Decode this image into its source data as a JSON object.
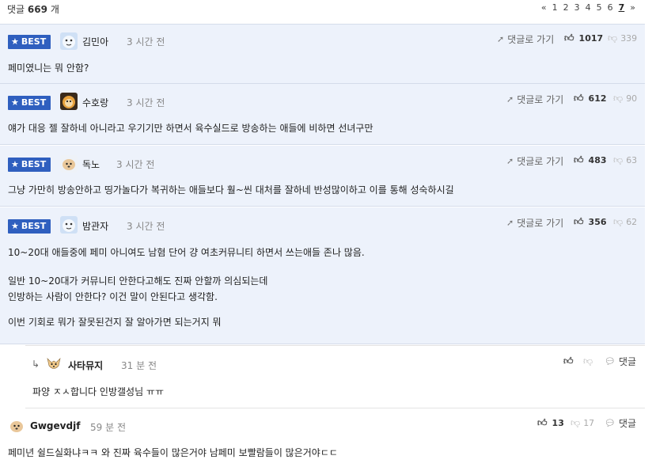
{
  "header": {
    "count_label": "댓글",
    "count_value": "669",
    "count_unit": "개",
    "pager": {
      "prev": "«",
      "pages": [
        "1",
        "2",
        "3",
        "4",
        "5",
        "6",
        "7"
      ],
      "current": "7",
      "next": "»"
    }
  },
  "labels": {
    "best": "BEST",
    "goto": "댓글로 가기",
    "reply": "댓글"
  },
  "best_comments": [
    {
      "nick": "김민아",
      "time": "3 시간 전",
      "likes": "1017",
      "dislikes": "339",
      "text": [
        "페미였니는 뭐 안함?"
      ]
    },
    {
      "nick": "수호랑",
      "time": "3 시간 전",
      "likes": "612",
      "dislikes": "90",
      "text": [
        "얘가 대응 젤 잘하네 아니라고 우기기만 하면서 육수실드로 방송하는 애들에 비하면 선녀구만"
      ]
    },
    {
      "nick": "독노",
      "time": "3 시간 전",
      "likes": "483",
      "dislikes": "63",
      "text": [
        "그냥 가만히 방송안하고 띵가놀다가 복귀하는 애들보다 훨~씬 대처를 잘하네 반성많이하고 이를 통해 성숙하시길"
      ]
    },
    {
      "nick": "밤관자",
      "time": "3 시간 전",
      "likes": "356",
      "dislikes": "62",
      "text": [
        "10~20대 애들중에 페미 아니여도 남혐 단어 걍 여초커뮤니티 하면서 쓰는애들 존나 많음.",
        "",
        "일반 10~20대가 커뮤니티 안한다고해도 진짜 안할까 의심되는데",
        "인방하는 사람이 안한다? 이건 말이 안된다고 생각함.",
        "",
        "이번 기회로 뭐가 잘못된건지 잘 알아가면 되는거지 뭐"
      ]
    }
  ],
  "reply": {
    "nick": "사타뮤지",
    "time": "31 분 전",
    "text": "파양 ㅈㅅ합니다 인방갤성님 ㅠㅠ"
  },
  "comment": {
    "nick": "Gwgevdjf",
    "time": "59 분 전",
    "likes": "13",
    "dislikes": "17",
    "text": "페미년 쉴드실화냐ㅋㅋ 와 진짜 육수들이 많은거야 남페미 보빨람들이 많은거야ㄷㄷ"
  },
  "colors": {
    "best_bg": "#edf2fb",
    "badge_bg": "#2f5fbf",
    "pager_current": "#222222"
  },
  "icons": {
    "best_star": "star-icon",
    "goto": "send-arrow-icon",
    "like": "thumbs-up-icon",
    "dislike": "thumbs-down-icon",
    "reply_arrow": "reply-arrow-icon",
    "reply_bubble": "speech-bubble-icon"
  }
}
